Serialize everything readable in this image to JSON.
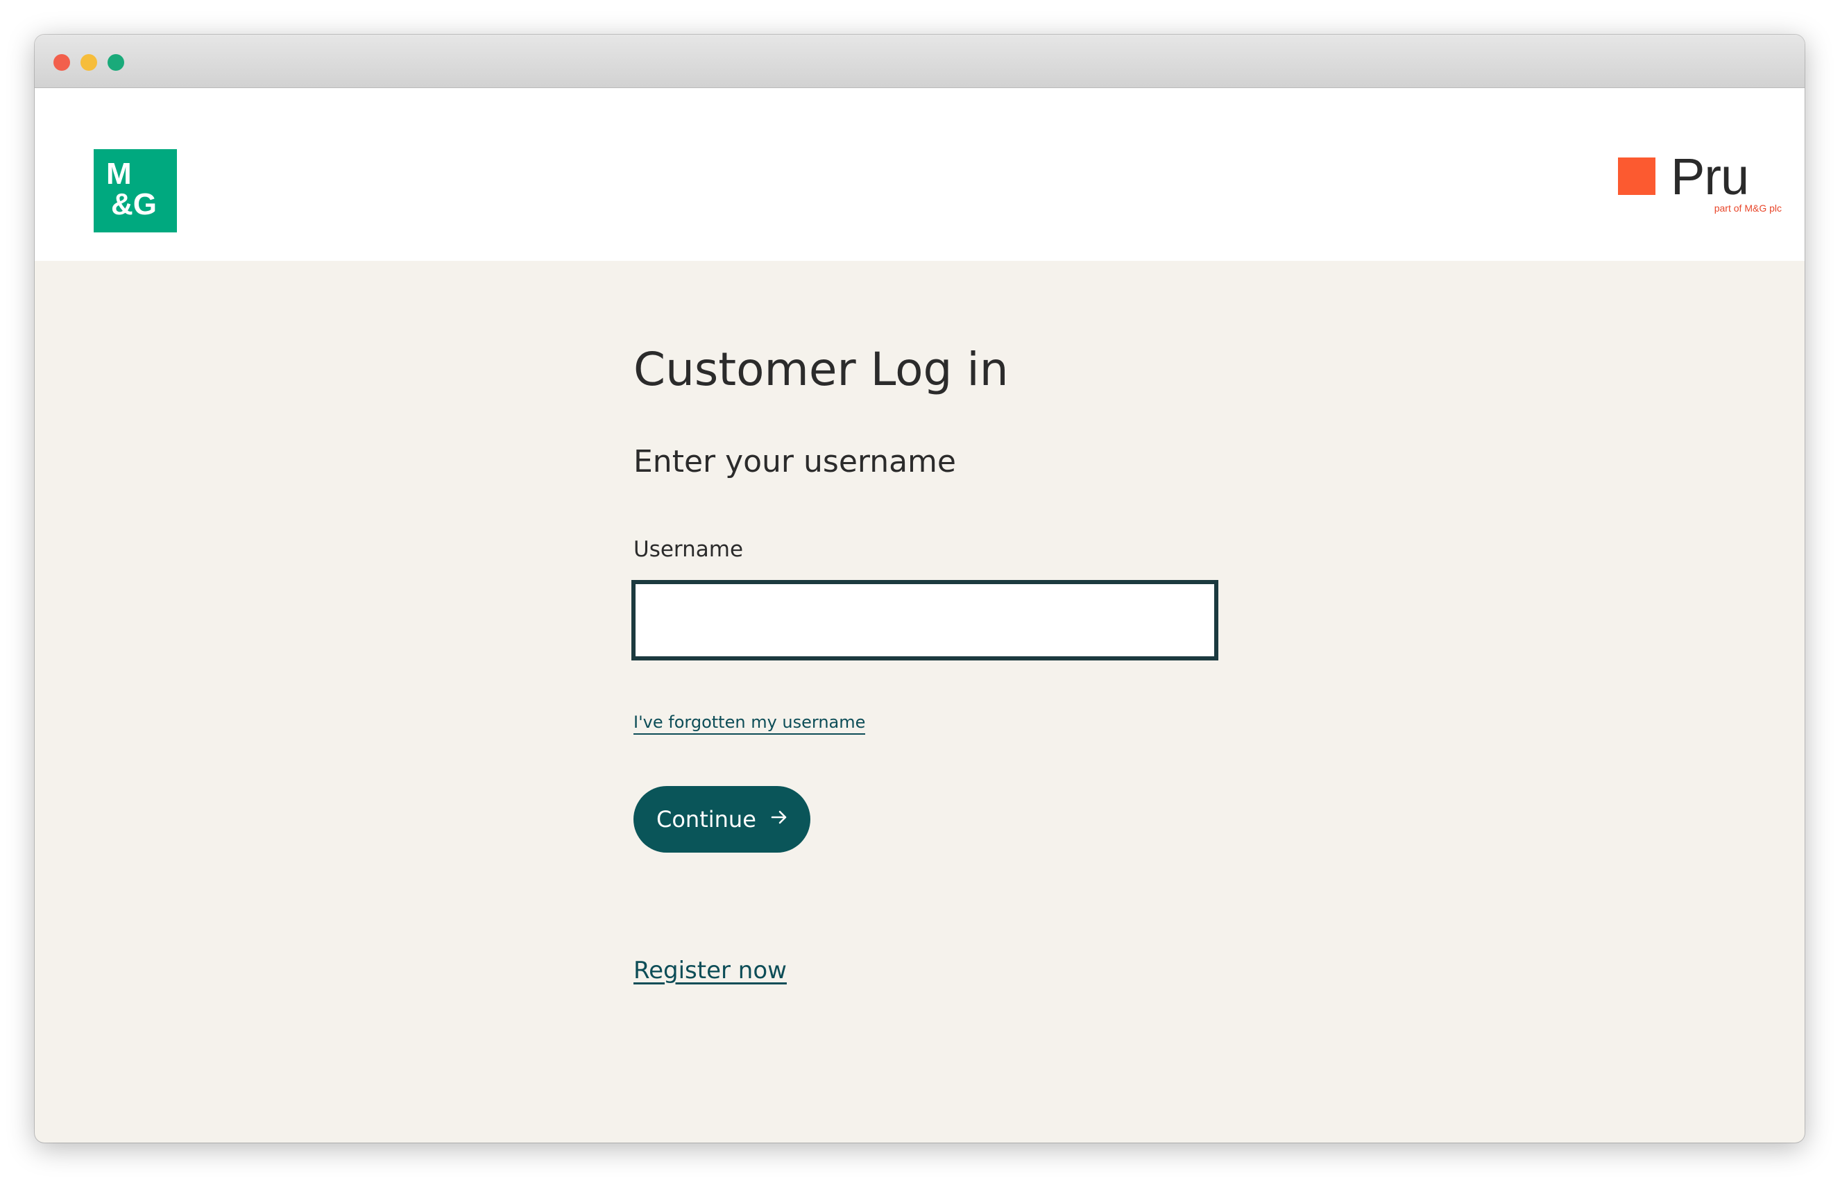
{
  "header": {
    "mg_logo": {
      "line1": "M",
      "line2": "&G"
    },
    "pru_logo": {
      "word": "Pru",
      "tagline": "part of M&G plc"
    }
  },
  "main": {
    "title": "Customer Log in",
    "subtitle": "Enter your username",
    "username": {
      "label": "Username",
      "value": "",
      "placeholder": ""
    },
    "forgot_link": "I've forgotten my username",
    "continue_label": "Continue",
    "continue_icon": "arrow-right-icon",
    "register_link": "Register now"
  },
  "colors": {
    "brand_green": "#00a97f",
    "pru_orange": "#fc5a30",
    "primary_teal": "#0a5559",
    "background": "#f5f2ec"
  }
}
